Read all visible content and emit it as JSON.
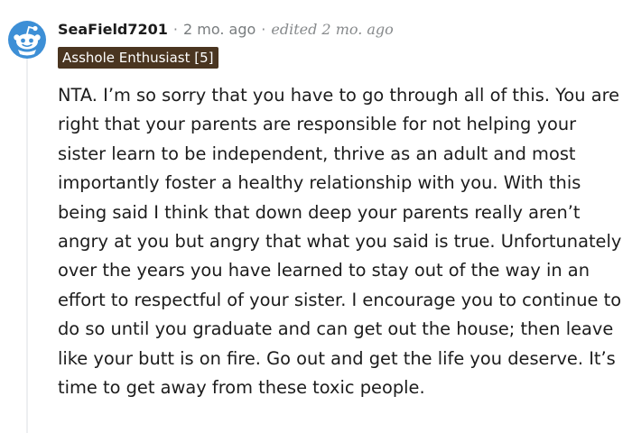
{
  "comment": {
    "author": "SeaField7201",
    "separator": "·",
    "time": "2 mo. ago",
    "edited": "edited 2 mo. ago",
    "flair": "Asshole Enthusiast [5]",
    "body": "NTA. I’m so sorry that you have to go through all of this. You are right that your parents are responsible for not helping your sister learn to be independent, thrive as an adult and most importantly foster a healthy relationship with you. With this being said I think that down deep your parents really aren’t angry at you but angry that what you said is true. Unfortunately over the years you have learned to stay out of the way in an effort to respectful of your sister. I encourage you to continue to do so until you graduate and can get out the house; then leave like your butt is on fire. Go out and get the life you deserve. It’s time to get away from these toxic people."
  },
  "icons": {
    "avatar": "snoo-avatar-icon"
  },
  "colors": {
    "avatar_blue": "#3d8fd6",
    "flair_background": "#4a3520",
    "flair_text": "#ffffff",
    "meta_text": "#787c7e",
    "body_text": "#1c1c1c",
    "thread_line": "#edeff1"
  }
}
